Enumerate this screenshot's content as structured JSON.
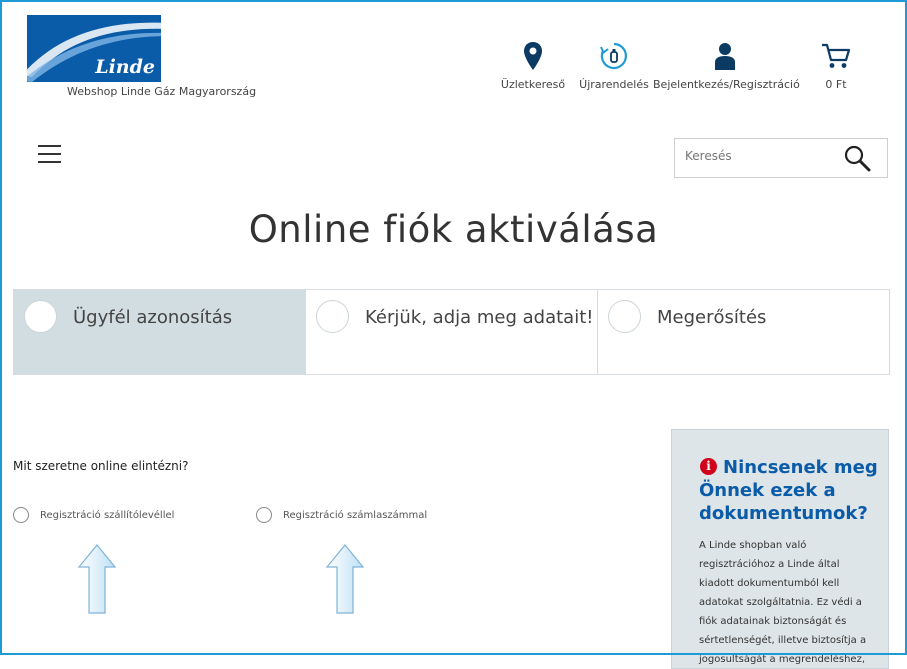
{
  "header": {
    "logo_text": "Linde",
    "shop_subtitle": "Webshop Linde Gáz Magyarország",
    "nav": [
      {
        "label": "Üzletkereső",
        "icon": "location-pin-icon"
      },
      {
        "label": "Újrarendelés",
        "icon": "reorder-icon"
      },
      {
        "label": "Bejelentkezés/Regisztráció",
        "icon": "user-icon"
      },
      {
        "label": "0 Ft",
        "icon": "cart-icon"
      }
    ]
  },
  "search": {
    "placeholder": "Keresés"
  },
  "page_title": "Online fiók aktiválása",
  "steps": [
    {
      "label": "Ügyfél azonosítás",
      "active": true
    },
    {
      "label": "Kérjük, adja meg adatait!",
      "active": false
    },
    {
      "label": "Megerősítés",
      "active": false
    }
  ],
  "form": {
    "question": "Mit szeretne online elintézni?",
    "options": [
      {
        "label": "Regisztráció szállítólevéllel"
      },
      {
        "label": "Regisztráció számlaszámmal"
      }
    ]
  },
  "sidebar": {
    "title": "Nincsenek meg Önnek ezek a dokumentumok?",
    "text": "A Linde shopban való regisztrációhoz a Linde által kiadott dokumentumból kell adatokat szolgáltatnia. Ez védi a fiók adatainak biztonságát és sértetlenségét, illetve biztosítja a jogosultságát a megrendeléshez,"
  },
  "colors": {
    "brand": "#0a5ba8",
    "frame": "#1e9bd7",
    "active_step": "#d2dde1",
    "warning": "#d0021b"
  }
}
